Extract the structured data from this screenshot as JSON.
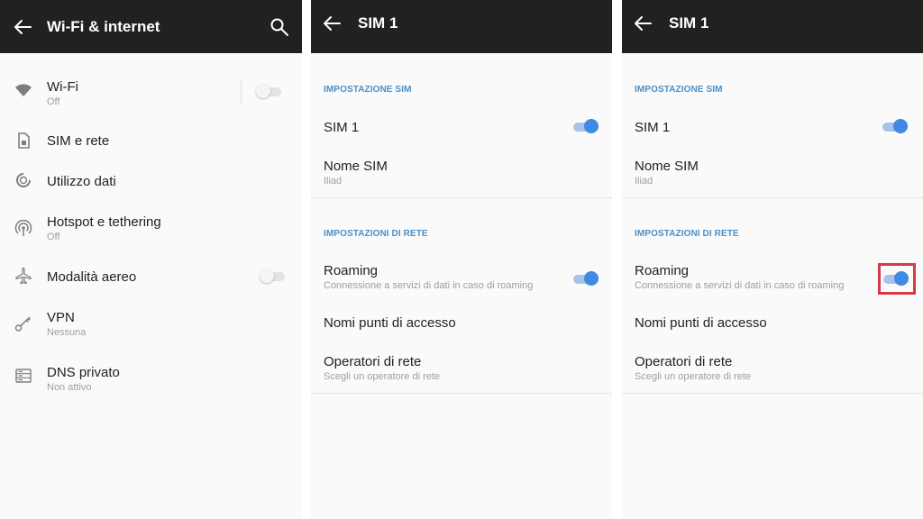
{
  "colors": {
    "topbar": "#212121",
    "background": "#fafafa",
    "accent": "#3f8ae2",
    "section_header": "#4a90c9",
    "highlight": "#d63a49"
  },
  "left_panel": {
    "title": "Wi-Fi & internet",
    "icons": {
      "back": "back-arrow-icon",
      "search": "search-icon"
    },
    "items": [
      {
        "label": "Wi-Fi",
        "sublabel": "Off",
        "icon": "wifi-icon",
        "toggle": "off"
      },
      {
        "label": "SIM e rete",
        "icon": "sim-card-icon"
      },
      {
        "label": "Utilizzo dati",
        "icon": "data-usage-icon"
      },
      {
        "label": "Hotspot e tethering",
        "sublabel": "Off",
        "icon": "hotspot-icon"
      },
      {
        "label": "Modalità aereo",
        "icon": "airplane-icon",
        "toggle": "off"
      },
      {
        "label": "VPN",
        "sublabel": "Nessuna",
        "icon": "vpn-key-icon"
      },
      {
        "label": "DNS privato",
        "sublabel": "Non attivo",
        "icon": "dns-icon"
      }
    ]
  },
  "middle_panel": {
    "title": "SIM 1",
    "sim_section": "IMPOSTAZIONE SIM",
    "sim_toggle_label": "SIM 1",
    "sim_toggle": "on",
    "sim_name_label": "Nome SIM",
    "sim_name_value": "Iliad",
    "network_section": "IMPOSTAZIONI DI RETE",
    "roaming_label": "Roaming",
    "roaming_desc": "Connessione a servizi di dati in caso di roaming",
    "roaming_toggle": "on",
    "apn_label": "Nomi punti di accesso",
    "operators_label": "Operatori di rete",
    "operators_desc": "Scegli un operatore di rete"
  },
  "right_panel": {
    "title": "SIM 1",
    "sim_section": "IMPOSTAZIONE SIM",
    "sim_toggle_label": "SIM 1",
    "sim_toggle": "on",
    "sim_name_label": "Nome SIM",
    "sim_name_value": "Iliad",
    "network_section": "IMPOSTAZIONI DI RETE",
    "roaming_label": "Roaming",
    "roaming_desc": "Connessione a servizi di dati in caso di roaming",
    "roaming_toggle": "on",
    "roaming_highlighted": true,
    "apn_label": "Nomi punti di accesso",
    "operators_label": "Operatori di rete",
    "operators_desc": "Scegli un operatore di rete"
  }
}
